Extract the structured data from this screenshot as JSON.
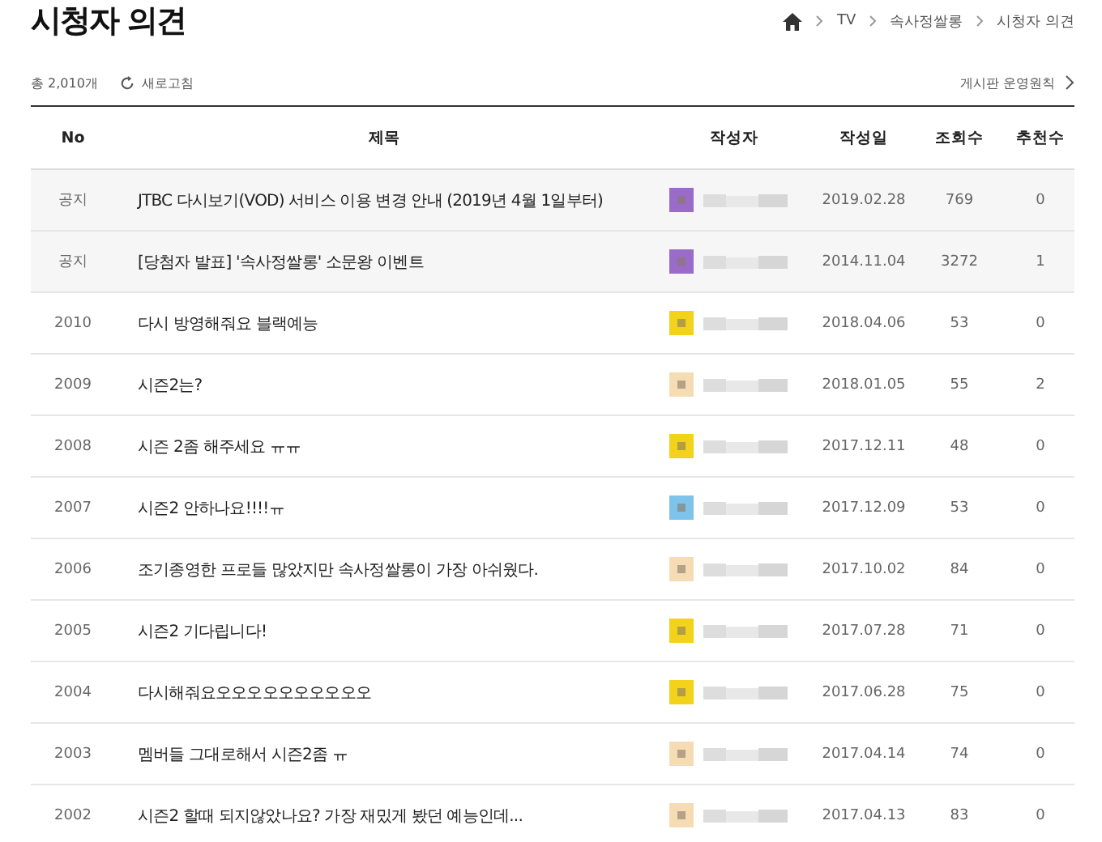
{
  "page_title": "시청자 의견",
  "breadcrumb": [
    "TV",
    "속사정쌀롱",
    "시청자 의견"
  ],
  "total": "총 2,010개",
  "refresh": "새로고침",
  "rules_link": "게시판 운영원칙",
  "table": {
    "columns": [
      "No",
      "제목",
      "작성자",
      "작성일",
      "조회수",
      "추천수"
    ],
    "rows": [
      {
        "no": "공지",
        "title": "JTBC 다시보기(VOD) 서비스 이용 변경 안내 (2019년 4월 1일부터)",
        "color": "#9a6bc9",
        "date": "2019.02.28",
        "views": "769",
        "likes": "0",
        "kind": "notice"
      },
      {
        "no": "공지",
        "title": "[당첨자 발표] '속사정쌀롱' 소문왕 이벤트",
        "color": "#9a6bc9",
        "date": "2014.11.04",
        "views": "3272",
        "likes": "1",
        "kind": "notice"
      },
      {
        "no": "2010",
        "title": "다시 방영해줘요 블랙예능",
        "color": "#f2d21a",
        "date": "2018.04.06",
        "views": "53",
        "likes": "0",
        "kind": "post"
      },
      {
        "no": "2009",
        "title": "시즌2는?",
        "color": "#f5dcb4",
        "date": "2018.01.05",
        "views": "55",
        "likes": "2",
        "kind": "post"
      },
      {
        "no": "2008",
        "title": "시즌 2좀 해주세요 ㅠㅠ",
        "color": "#f2d21a",
        "date": "2017.12.11",
        "views": "48",
        "likes": "0",
        "kind": "post"
      },
      {
        "no": "2007",
        "title": "시즌2 안하나요!!!!ㅠ",
        "color": "#7ec3ea",
        "date": "2017.12.09",
        "views": "53",
        "likes": "0",
        "kind": "post"
      },
      {
        "no": "2006",
        "title": "조기종영한 프로들 많았지만 속사정쌀롱이 가장 아쉬웠다.",
        "color": "#f5dcb4",
        "date": "2017.10.02",
        "views": "84",
        "likes": "0",
        "kind": "post"
      },
      {
        "no": "2005",
        "title": "시즌2 기다립니다!",
        "color": "#f2d21a",
        "date": "2017.07.28",
        "views": "71",
        "likes": "0",
        "kind": "post"
      },
      {
        "no": "2004",
        "title": "다시해줘요오오오오오오오오오오",
        "color": "#f2d21a",
        "date": "2017.06.28",
        "views": "75",
        "likes": "0",
        "kind": "post"
      },
      {
        "no": "2003",
        "title": "멤버들 그대로해서 시즌2좀 ㅠ",
        "color": "#f5dcb4",
        "date": "2017.04.14",
        "views": "74",
        "likes": "0",
        "kind": "post"
      },
      {
        "no": "2002",
        "title": "시즌2 할때 되지않았나요? 가장 재밌게 봤던 예능인데...",
        "color": "#f5dcb4",
        "date": "2017.04.13",
        "views": "83",
        "likes": "0",
        "kind": "post"
      }
    ]
  }
}
